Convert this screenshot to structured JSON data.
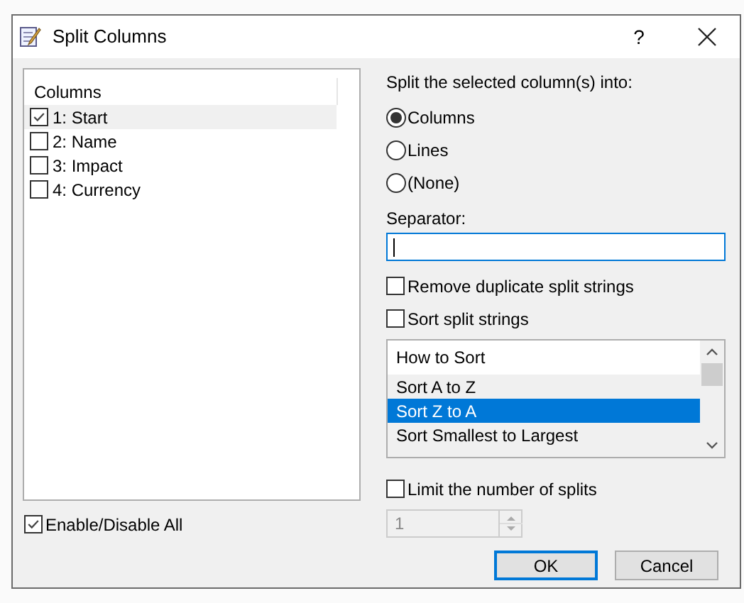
{
  "window": {
    "title": "Split Columns",
    "help_button": "?"
  },
  "columns_list": {
    "header": "Columns",
    "items": [
      {
        "label": "1: Start",
        "checked": true,
        "selected": true
      },
      {
        "label": "2: Name",
        "checked": false,
        "selected": false
      },
      {
        "label": "3: Impact",
        "checked": false,
        "selected": false
      },
      {
        "label": "4: Currency",
        "checked": false,
        "selected": false
      }
    ]
  },
  "enable_disable_all": {
    "label": "Enable/Disable All",
    "checked": true
  },
  "split_into": {
    "label": "Split the selected column(s) into:",
    "options": [
      {
        "label": "Columns",
        "selected": true
      },
      {
        "label": "Lines",
        "selected": false
      },
      {
        "label": "(None)",
        "selected": false
      }
    ]
  },
  "separator": {
    "label": "Separator:",
    "focused": true
  },
  "options": [
    {
      "label": "Remove duplicate split strings",
      "checked": false
    },
    {
      "label": "Sort split strings",
      "checked": false
    }
  ],
  "sort_list": {
    "header": "How to Sort",
    "items": [
      {
        "label": "Sort A to Z",
        "selected": false
      },
      {
        "label": "Sort Z to A",
        "selected": true
      },
      {
        "label": "Sort Smallest to Largest",
        "selected": false
      }
    ]
  },
  "limit_splits": {
    "label": "Limit the number of splits",
    "checked": false
  },
  "split_count": {
    "value": "1",
    "disabled": true
  },
  "buttons": [
    {
      "label": "OK",
      "default": true
    },
    {
      "label": "Cancel",
      "default": false
    }
  ]
}
